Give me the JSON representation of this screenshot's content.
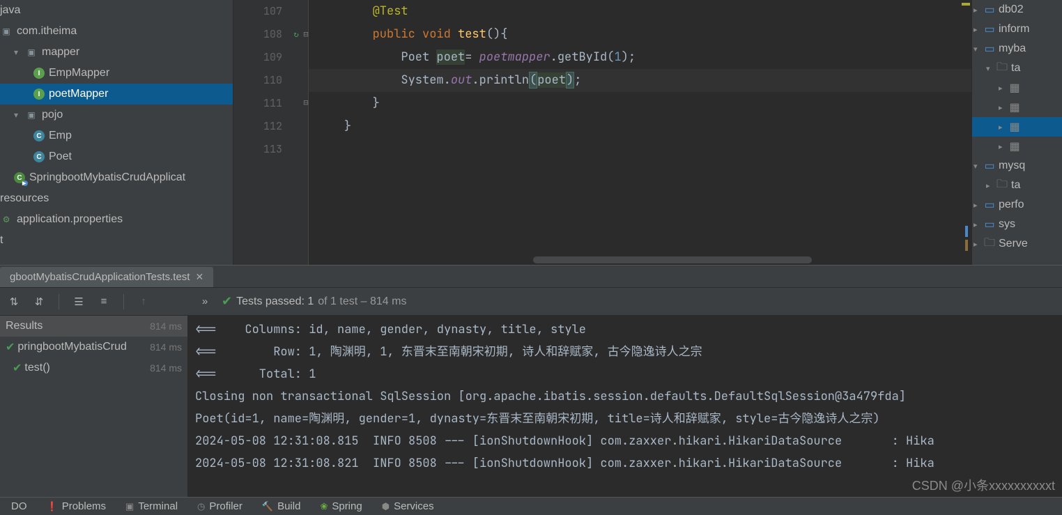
{
  "project_tree": {
    "root1": "java",
    "root2": "com.itheima",
    "mapper_folder": "mapper",
    "emp_mapper": "EmpMapper",
    "poet_mapper": "poetMapper",
    "pojo_folder": "pojo",
    "emp": "Emp",
    "poet": "Poet",
    "app_class": "SpringbootMybatisCrudApplicat",
    "resources": "resources",
    "app_props": "application.properties",
    "t": "t"
  },
  "editor": {
    "lines": {
      "107": "107",
      "108": "108",
      "109": "109",
      "110": "110",
      "111": "111",
      "112": "112",
      "113": "113"
    },
    "code": {
      "l107_annotation": "@Test",
      "l108_public": "public",
      "l108_void": "void",
      "l108_method": "test",
      "l108_paren": "(){",
      "l109_type": "Poet",
      "l109_var": "poet",
      "l109_eq": "= ",
      "l109_field": "poetmapper",
      "l109_call": ".getById(",
      "l109_num": "1",
      "l109_end": ");",
      "l110_sys": "System.",
      "l110_out": "out",
      "l110_print": ".println",
      "l110_lp": "(",
      "l110_arg": "poet",
      "l110_rp": ")",
      "l110_sc": ";",
      "l111_brace": "}",
      "l112_brace": "}"
    }
  },
  "db_tree": {
    "items": [
      {
        "icon": "schema",
        "label": "db02",
        "arrow": ">",
        "indent": 0
      },
      {
        "icon": "schema",
        "label": "inform",
        "arrow": ">",
        "indent": 0
      },
      {
        "icon": "schema",
        "label": "myba",
        "arrow": "v",
        "indent": 0
      },
      {
        "icon": "folder",
        "label": "ta",
        "arrow": "v",
        "indent": 1
      },
      {
        "icon": "table",
        "label": "",
        "arrow": ">",
        "indent": 2
      },
      {
        "icon": "table",
        "label": "",
        "arrow": ">",
        "indent": 2
      },
      {
        "icon": "table",
        "label": "",
        "arrow": ">",
        "indent": 2,
        "sel": true
      },
      {
        "icon": "table",
        "label": "",
        "arrow": ">",
        "indent": 2
      },
      {
        "icon": "schema",
        "label": "mysq",
        "arrow": "v",
        "indent": 0
      },
      {
        "icon": "folder",
        "label": "ta",
        "arrow": ">",
        "indent": 1
      },
      {
        "icon": "schema",
        "label": "perfo",
        "arrow": ">",
        "indent": 0
      },
      {
        "icon": "schema",
        "label": "sys",
        "arrow": ">",
        "indent": 0
      },
      {
        "icon": "folder",
        "label": "Serve",
        "arrow": ">",
        "indent": 0
      }
    ]
  },
  "run": {
    "tab_name": "gbootMybatisCrudApplicationTests.test",
    "status_passed": "Tests passed: 1",
    "status_of": " of 1 test – 814 ms",
    "tree": {
      "header": "Results",
      "header_time": "814 ms",
      "row1": "pringbootMybatisCrud",
      "row1_time": "814 ms",
      "row2": "test()",
      "row2_time": "814 ms"
    },
    "console_lines": [
      "<==    Columns: id, name, gender, dynasty, title, style",
      "<==        Row: 1, 陶渊明, 1, 东晋末至南朝宋初期, 诗人和辞赋家, 古今隐逸诗人之宗",
      "<==      Total: 1",
      "Closing non transactional SqlSession [org.apache.ibatis.session.defaults.DefaultSqlSession@3a479fda]",
      "Poet(id=1, name=陶渊明, gender=1, dynasty=东晋末至南朝宋初期, title=诗人和辞赋家, style=古今隐逸诗人之宗)",
      "2024-05-08 12:31:08.815  INFO 8508 --- [ionShutdownHook] com.zaxxer.hikari.HikariDataSource       : Hika",
      "2024-05-08 12:31:08.821  INFO 8508 --- [ionShutdownHook] com.zaxxer.hikari.HikariDataSource       : Hika"
    ]
  },
  "bottom": {
    "todo": "DO",
    "problems": "Problems",
    "terminal": "Terminal",
    "profiler": "Profiler",
    "build": "Build",
    "spring": "Spring",
    "services": "Services"
  },
  "watermark": "CSDN @小条xxxxxxxxxxt"
}
